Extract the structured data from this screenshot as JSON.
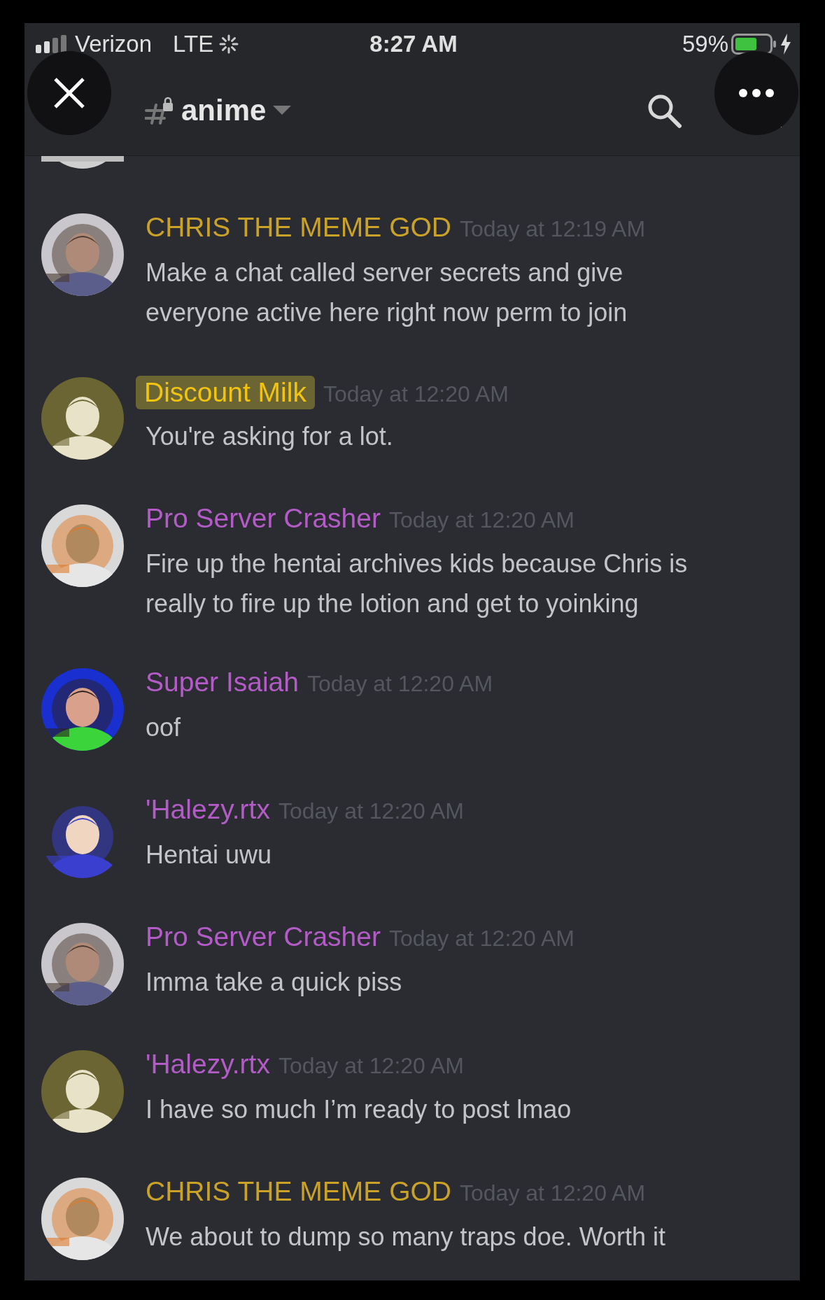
{
  "status_bar": {
    "carrier": "Verizon",
    "network": "LTE",
    "time": "8:27 AM",
    "battery": "59%"
  },
  "header": {
    "channel": "anime"
  },
  "messages": [
    {
      "author": "CHRIS THE MEME GOD",
      "color": "#c9a227",
      "timestamp": "Today at 12:19 AM",
      "text": "Make a chat called server secrets and give everyone active here right now perm to join",
      "highlighted": false
    },
    {
      "author": "Discount Milk",
      "color": "#f1c40f",
      "timestamp": "Today at 12:20 AM",
      "text": "You're asking for a lot.",
      "highlighted": true
    },
    {
      "author": "Pro Server Crasher",
      "color": "#b35bc7",
      "timestamp": "Today at 12:20 AM",
      "text": "Fire up the hentai archives kids because Chris is really to fire up the lotion and get to yoinking",
      "highlighted": false
    },
    {
      "author": "Super Isaiah",
      "color": "#b35bc7",
      "timestamp": "Today at 12:20 AM",
      "text": "oof",
      "highlighted": false
    },
    {
      "author": "'Halezy.rtx",
      "color": "#b35bc7",
      "timestamp": "Today at 12:20 AM",
      "text": "Hentai uwu",
      "highlighted": false
    },
    {
      "author": "Pro Server Crasher",
      "color": "#b35bc7",
      "timestamp": "Today at 12:20 AM",
      "text": "Imma take a quick piss",
      "highlighted": false
    },
    {
      "author": "'Halezy.rtx",
      "color": "#b35bc7",
      "timestamp": "Today at 12:20 AM",
      "text": "I have so much I’m ready to post lmao",
      "highlighted": false
    },
    {
      "author": "CHRIS THE MEME GOD",
      "color": "#c9a227",
      "timestamp": "Today at 12:20 AM",
      "text": "We about to dump so many traps doe. Worth it",
      "highlighted": false
    }
  ]
}
